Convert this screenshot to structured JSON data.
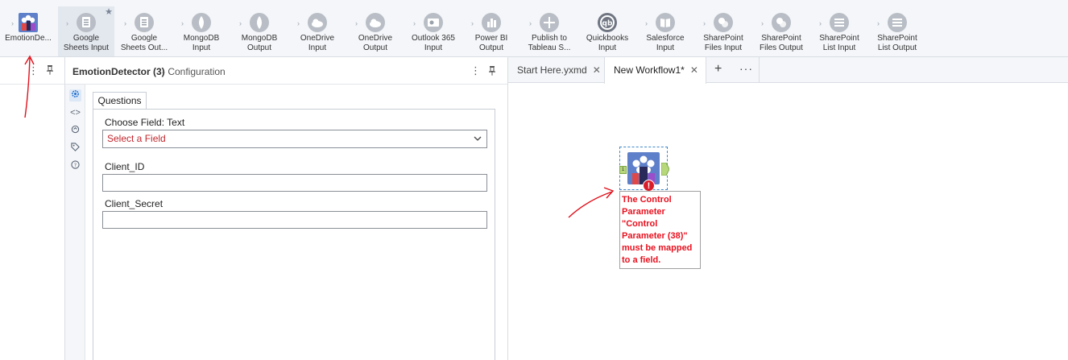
{
  "palette": {
    "tools": [
      {
        "label": "EmotionDe...",
        "icon": "emotion-detector-icon"
      },
      {
        "label": "Google\nSheets Input",
        "icon": "google-sheets-input-icon"
      },
      {
        "label": "Google\nSheets Out...",
        "icon": "google-sheets-output-icon"
      },
      {
        "label": "MongoDB\nInput",
        "icon": "mongodb-input-icon"
      },
      {
        "label": "MongoDB\nOutput",
        "icon": "mongodb-output-icon"
      },
      {
        "label": "OneDrive\nInput",
        "icon": "onedrive-input-icon"
      },
      {
        "label": "OneDrive\nOutput",
        "icon": "onedrive-output-icon"
      },
      {
        "label": "Outlook 365\nInput",
        "icon": "outlook-365-input-icon"
      },
      {
        "label": "Power BI\nOutput",
        "icon": "power-bi-output-icon"
      },
      {
        "label": "Publish to\nTableau S...",
        "icon": "publish-tableau-icon"
      },
      {
        "label": "Quickbooks\nInput",
        "icon": "quickbooks-input-icon"
      },
      {
        "label": "Salesforce\nInput",
        "icon": "salesforce-input-icon"
      },
      {
        "label": "SharePoint\nFiles Input",
        "icon": "sharepoint-files-input-icon"
      },
      {
        "label": "SharePoint\nFiles Output",
        "icon": "sharepoint-files-output-icon"
      },
      {
        "label": "SharePoint\nList Input",
        "icon": "sharepoint-list-input-icon"
      },
      {
        "label": "SharePoint\nList Output",
        "icon": "sharepoint-list-output-icon"
      }
    ]
  },
  "config": {
    "title": "EmotionDetector (3)",
    "subtitle": "- Configuration",
    "tab_label": "Questions",
    "fields": {
      "choose_label": "Choose Field: Text",
      "choose_placeholder": "Select a Field",
      "client_id_label": "Client_ID",
      "client_id_value": "",
      "client_secret_label": "Client_Secret",
      "client_secret_value": ""
    }
  },
  "canvas": {
    "tabs": [
      {
        "label": "Start Here.yxmd"
      },
      {
        "label": "New Workflow1*"
      }
    ],
    "close_glyph": "✕",
    "add_glyph": "+",
    "more_glyph": "···",
    "node": {
      "anchor_label": "1",
      "error_glyph": "!",
      "error_message": "The Control\nParameter\n\"Control\nParameter (38)\"\nmust be mapped\nto a field."
    }
  },
  "colors": {
    "error_red": "#e8101e",
    "accent_blue": "#1c6dd0",
    "annotation_red": "#e0101b"
  }
}
